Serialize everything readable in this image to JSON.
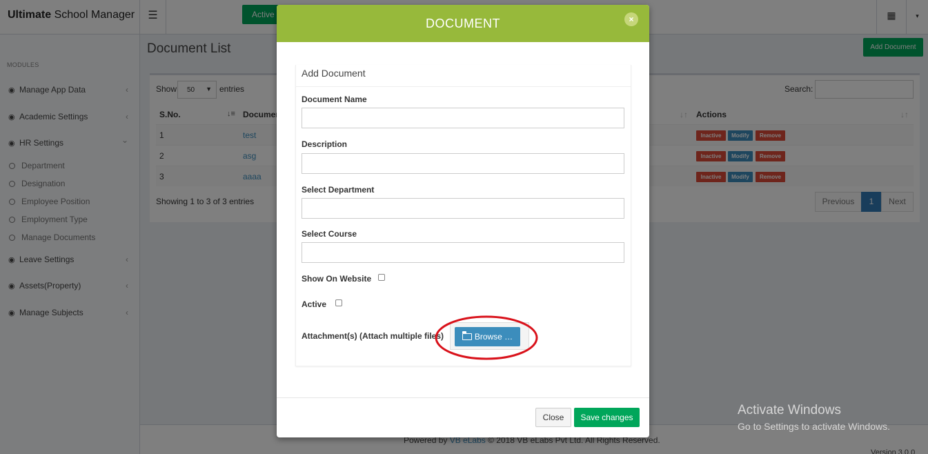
{
  "app": {
    "brand_bold": "Ultimate",
    "brand_rest": " School Manager",
    "menu_icon": "☰",
    "active_label": "Active",
    "grid_icon": "▦",
    "caret_icon": "▾"
  },
  "sidebar": {
    "header": "MODULES",
    "items": [
      {
        "label": "Manage App Data",
        "icon": "gauge-icon",
        "chevron": "‹"
      },
      {
        "label": "Academic Settings",
        "icon": "gauge-icon",
        "chevron": "‹"
      },
      {
        "label": "HR Settings",
        "icon": "gauge-icon",
        "chevron": "⌄"
      },
      {
        "label": "Leave Settings",
        "icon": "gauge-icon",
        "chevron": "‹"
      },
      {
        "label": "Assets(Property)",
        "icon": "gauge-icon",
        "chevron": "‹"
      },
      {
        "label": "Manage Subjects",
        "icon": "gauge-icon",
        "chevron": "‹"
      }
    ],
    "hr_sub": [
      "Department",
      "Designation",
      "Employee Position",
      "Employment Type",
      "Manage Documents"
    ]
  },
  "content": {
    "title": "Document List",
    "add_button": "Add Document",
    "show_label": "Show",
    "show_value": "50",
    "entries_label": "entries",
    "search_label": "Search:",
    "columns": {
      "sno": "S.No.",
      "document": "Documer",
      "actions": "Actions"
    },
    "rows": [
      {
        "sno": "1",
        "name": "test"
      },
      {
        "sno": "2",
        "name": "asg"
      },
      {
        "sno": "3",
        "name": "aaaa"
      }
    ],
    "actions": {
      "inactive": "Inactive",
      "modify": "Modify",
      "remove": "Remove"
    },
    "info": "Showing 1 to 3 of 3 entries",
    "pagination": {
      "previous": "Previous",
      "current": "1",
      "next": "Next"
    }
  },
  "footer": {
    "powered": "Powered by ",
    "link": "VB eLabs",
    "rest": " © 2018 VB eLabs Pvt Ltd. All Rights Reserved.",
    "version": "Version 3.0.0"
  },
  "modal": {
    "title": "DOCUMENT",
    "close_icon": "×",
    "panel_title": "Add Document",
    "fields": {
      "document_name": {
        "label": "Document Name",
        "value": ""
      },
      "description": {
        "label": "Description",
        "value": ""
      },
      "department": {
        "label": "Select Department",
        "value": ""
      },
      "course": {
        "label": "Select Course",
        "value": ""
      }
    },
    "show_on_website": {
      "label": "Show On Website",
      "checked": false
    },
    "active": {
      "label": "Active",
      "checked": false
    },
    "attachments_label": "Attachment(s) (Attach multiple files)",
    "browse_label": "Browse …",
    "close_button": "Close",
    "save_button": "Save changes",
    "highlight_color": "#d9121b"
  },
  "watermark": {
    "line1": "Activate Windows",
    "line2": "Go to Settings to activate Windows."
  },
  "colors": {
    "modal_header": "#97b93b",
    "primary": "#3c8dbc",
    "success": "#00a65a",
    "danger": "#dd4b39"
  }
}
